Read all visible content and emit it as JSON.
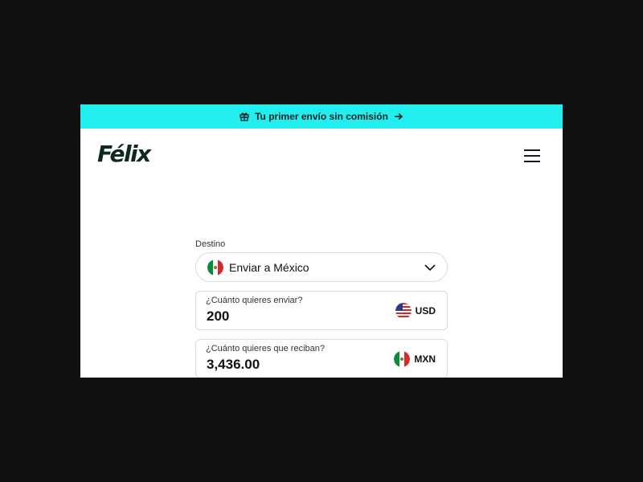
{
  "promo_banner": {
    "text": "Tu primer envío sin comisión",
    "icon": "gift-icon",
    "arrow_icon": "arrow-right-icon",
    "color": "#22eef0"
  },
  "header": {
    "logo": "Félix",
    "menu_icon": "hamburger-menu-icon"
  },
  "form": {
    "destination_label": "Destino",
    "destination_value": "Enviar a México",
    "destination_flag": "mexico-flag-icon",
    "send": {
      "label": "¿Cuánto quieres enviar?",
      "value": "200",
      "currency": "USD",
      "flag": "us-flag-icon"
    },
    "receive": {
      "label": "¿Cuánto quieres que reciban?",
      "value": "3,436.00",
      "currency": "MXN",
      "flag": "mexico-flag-icon"
    }
  }
}
